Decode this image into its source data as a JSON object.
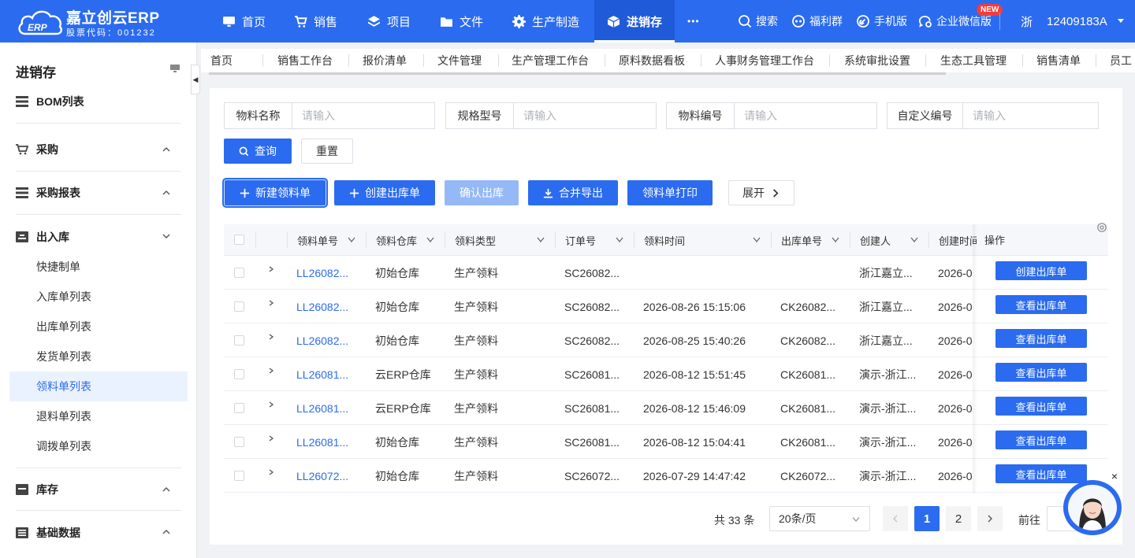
{
  "brand": {
    "title": "嘉立创云ERP",
    "subtitle": "股票代码：001232",
    "logo_text": "ERP"
  },
  "nav": [
    {
      "label": "首页",
      "icon": "monitor-icon"
    },
    {
      "label": "销售",
      "icon": "cart-icon"
    },
    {
      "label": "项目",
      "icon": "layers-icon"
    },
    {
      "label": "文件",
      "icon": "folder-icon"
    },
    {
      "label": "生产制造",
      "icon": "gear-icon"
    },
    {
      "label": "进销存",
      "icon": "box-icon",
      "active": true
    },
    {
      "label": "•••",
      "icon": "more-icon"
    }
  ],
  "tools": {
    "search": "搜索",
    "welfare": "福利群",
    "mobile": "手机版",
    "wecom": "企业微信版",
    "new_badge": "NEW"
  },
  "user": {
    "region": "浙",
    "account": "12409183A"
  },
  "sidebar": {
    "title": "进销存",
    "groups": [
      {
        "label": "BOM列表",
        "icon": "list-icon"
      },
      {
        "label": "采购",
        "icon": "cart-icon",
        "expanded": false
      },
      {
        "label": "采购报表",
        "icon": "list-icon",
        "expanded": false
      },
      {
        "label": "出入库",
        "icon": "warehouse-icon",
        "expanded": true
      },
      {
        "label": "库存",
        "icon": "inventory-icon",
        "expanded": false
      },
      {
        "label": "基础数据",
        "icon": "data-icon",
        "expanded": false
      }
    ],
    "subitems": [
      "快捷制单",
      "入库单列表",
      "出库单列表",
      "发货单列表",
      "领料单列表",
      "退料单列表",
      "调拨单列表"
    ],
    "active_sub": "领料单列表"
  },
  "tabs": [
    "首页",
    "销售工作台",
    "报价清单",
    "文件管理",
    "生产管理工作台",
    "原料数据看板",
    "人事财务管理工作台",
    "系统审批设置",
    "生态工具管理",
    "销售清单",
    "员工"
  ],
  "filters": [
    {
      "label": "物料名称",
      "placeholder": "请输入"
    },
    {
      "label": "规格型号",
      "placeholder": "请输入"
    },
    {
      "label": "物料编号",
      "placeholder": "请输入"
    },
    {
      "label": "自定义编号",
      "placeholder": "请输入"
    }
  ],
  "buttons": {
    "query": "查询",
    "reset": "重置",
    "new_requisition": "新建领料单",
    "create_outbound": "创建出库单",
    "confirm_outbound": "确认出库",
    "merge_export": "合并导出",
    "print_requisition": "领料单打印",
    "expand": "展开"
  },
  "table": {
    "columns": [
      "领料单号",
      "领料仓库",
      "领料类型",
      "订单号",
      "领料时间",
      "出库单号",
      "创建人",
      "创建时间",
      "操作"
    ],
    "rows": [
      {
        "no": "LL26082...",
        "warehouse": "初始仓库",
        "type": "生产领料",
        "order": "SC26082...",
        "time": "",
        "outbound": "",
        "creator": "浙江嘉立...",
        "created": "2026-0",
        "action": "创建出库单"
      },
      {
        "no": "LL26082...",
        "warehouse": "初始仓库",
        "type": "生产领料",
        "order": "SC26082...",
        "time": "2026-08-26 15:15:06",
        "outbound": "CK26082...",
        "creator": "浙江嘉立...",
        "created": "2026-0",
        "action": "查看出库单"
      },
      {
        "no": "LL26082...",
        "warehouse": "初始仓库",
        "type": "生产领料",
        "order": "SC26082...",
        "time": "2026-08-25 15:40:26",
        "outbound": "CK26082...",
        "creator": "浙江嘉立...",
        "created": "2026-0",
        "action": "查看出库单"
      },
      {
        "no": "LL26081...",
        "warehouse": "云ERP仓库",
        "type": "生产领料",
        "order": "SC26081...",
        "time": "2026-08-12 15:51:45",
        "outbound": "CK26081...",
        "creator": "演示-浙江...",
        "created": "2026-0",
        "action": "查看出库单"
      },
      {
        "no": "LL26081...",
        "warehouse": "云ERP仓库",
        "type": "生产领料",
        "order": "SC26081...",
        "time": "2026-08-12 15:46:09",
        "outbound": "CK26081...",
        "creator": "演示-浙江...",
        "created": "2026-0",
        "action": "查看出库单"
      },
      {
        "no": "LL26081...",
        "warehouse": "初始仓库",
        "type": "生产领料",
        "order": "SC26081...",
        "time": "2026-08-12 15:04:41",
        "outbound": "CK26081...",
        "creator": "演示-浙江...",
        "created": "2026-0",
        "action": "查看出库单"
      },
      {
        "no": "LL26072...",
        "warehouse": "初始仓库",
        "type": "生产领料",
        "order": "SC26072...",
        "time": "2026-07-29 14:47:42",
        "outbound": "CK26072...",
        "creator": "演示-浙江...",
        "created": "2026-0",
        "action": "查看出库单"
      }
    ]
  },
  "pagination": {
    "total": "共 33 条",
    "page_size": "20条/页",
    "pages": [
      "1",
      "2"
    ],
    "current": "1",
    "goto": "前往"
  },
  "colors": {
    "primary": "#2b6bef",
    "disabled": "#95b9f7",
    "active_bg": "#ebf2ff"
  }
}
